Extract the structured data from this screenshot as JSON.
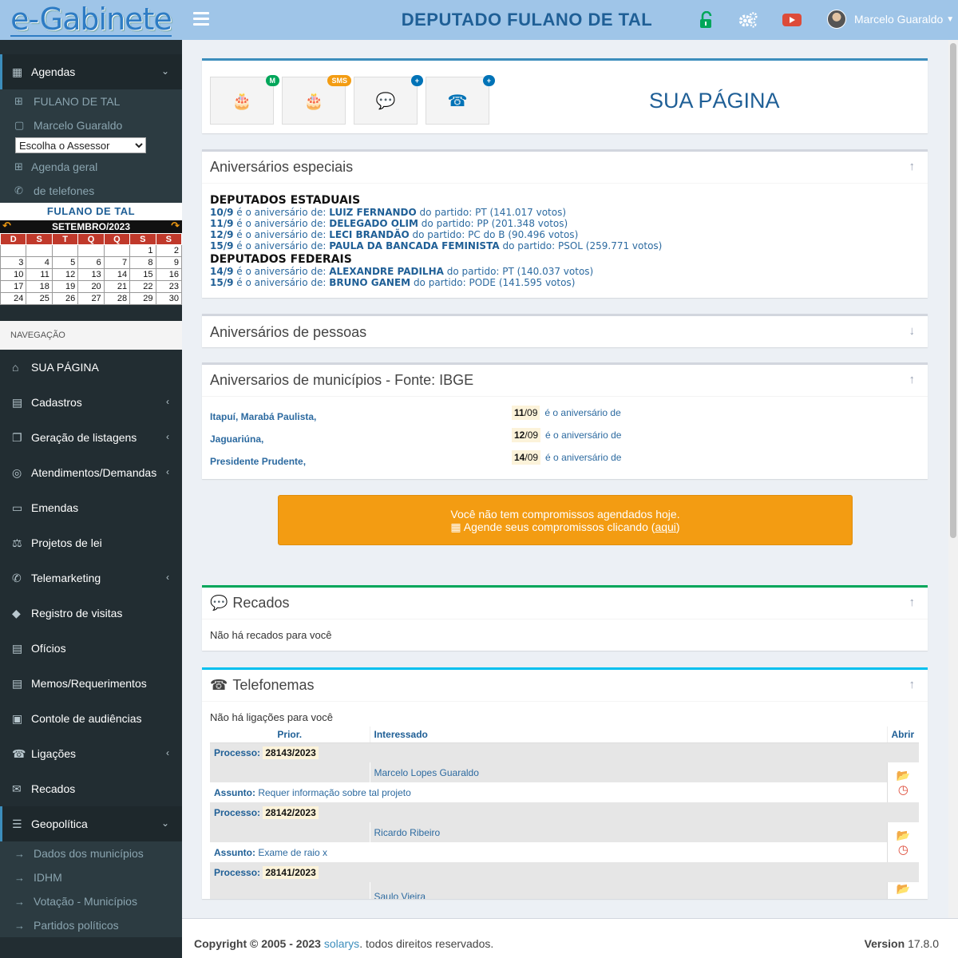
{
  "header": {
    "logo": "e-Gabinete",
    "title": "DEPUTADO FULANO DE TAL",
    "user": "Marcelo Guaraldo",
    "icons": [
      "lock-open-icon",
      "cogs-icon",
      "youtube-icon"
    ],
    "colors": {
      "bar": "#9fc5e8",
      "lock": "#00a65a",
      "youtube": "#dd4b39"
    }
  },
  "sidebar": {
    "agendas": {
      "label": "Agendas",
      "items": [
        "FULANO DE TAL",
        "Marcelo Guaraldo"
      ],
      "assessor_select": "Escolha o Assessor",
      "geral": "Agenda geral",
      "telefones": "de telefones"
    },
    "calendar": {
      "owner": "FULANO DE TAL",
      "month": "SETEMBRO/2023",
      "weekdays": [
        "D",
        "S",
        "T",
        "Q",
        "Q",
        "S",
        "S"
      ],
      "weeks": [
        [
          "",
          "",
          "",
          "",
          "",
          "1",
          "2"
        ],
        [
          "3",
          "4",
          "5",
          "6",
          "7",
          "8",
          "9"
        ],
        [
          "10",
          "11",
          "12",
          "13",
          "14",
          "15",
          "16"
        ],
        [
          "17",
          "18",
          "19",
          "20",
          "21",
          "22",
          "23"
        ],
        [
          "24",
          "25",
          "26",
          "27",
          "28",
          "29",
          "30"
        ]
      ]
    },
    "nav_label": "NAVEGAÇÃO",
    "nav": [
      {
        "label": "SUA PÁGINA",
        "icon": "home-icon",
        "chev": false
      },
      {
        "label": "Cadastros",
        "icon": "file-icon",
        "chev": true
      },
      {
        "label": "Geração de listagens",
        "icon": "copy-icon",
        "chev": true
      },
      {
        "label": "Atendimentos/Demandas",
        "icon": "lifering-icon",
        "chev": true
      },
      {
        "label": "Emendas",
        "icon": "money-icon",
        "chev": false
      },
      {
        "label": "Projetos de lei",
        "icon": "balance-icon",
        "chev": false
      },
      {
        "label": "Telemarketing",
        "icon": "phone-volume-icon",
        "chev": true
      },
      {
        "label": "Registro de visitas",
        "icon": "car-icon",
        "chev": false
      },
      {
        "label": "Ofícios",
        "icon": "file-text-icon",
        "chev": false
      },
      {
        "label": "Memos/Requerimentos",
        "icon": "file-text-icon",
        "chev": false
      },
      {
        "label": "Contole de audiências",
        "icon": "calendar-check-icon",
        "chev": false
      },
      {
        "label": "Ligações",
        "icon": "phone-square-icon",
        "chev": true
      },
      {
        "label": "Recados",
        "icon": "comments-icon",
        "chev": false
      }
    ],
    "geo": {
      "label": "Geopolítica",
      "items": [
        "Dados dos municípios",
        "IDHM",
        "Votação - Municípios",
        "Partidos políticos"
      ]
    }
  },
  "tiles": {
    "badges": [
      "M",
      "SMS",
      "+",
      "+"
    ],
    "icons": [
      "birthday-cake-icon",
      "birthday-cake-icon",
      "comments-icon",
      "phone-square-icon"
    ],
    "colors": [
      "#00a65a",
      "#f39c12",
      "#0073b7",
      "#0073b7"
    ],
    "page_title": "SUA PÁGINA"
  },
  "aniv_especiais": {
    "title": "Aniversários especiais",
    "estaduais_title": "DEPUTADOS ESTADUAIS",
    "estaduais": [
      {
        "date": "10/9",
        "name": "LUIZ FERNANDO",
        "party": "PT",
        "votes": "141.017 votos"
      },
      {
        "date": "11/9",
        "name": "DELEGADO OLIM",
        "party": "PP",
        "votes": "201.348 votos"
      },
      {
        "date": "12/9",
        "name": "LECI BRANDÃO",
        "party": "PC do B",
        "votes": "90.496 votos"
      },
      {
        "date": "15/9",
        "name": "PAULA DA BANCADA FEMINISTA",
        "party": "PSOL",
        "votes": "259.771 votos"
      }
    ],
    "federais_title": "DEPUTADOS FEDERAIS",
    "federais": [
      {
        "date": "14/9",
        "name": "ALEXANDRE PADILHA",
        "party": "PT",
        "votes": "140.037 votos"
      },
      {
        "date": "15/9",
        "name": "BRUNO GANEM",
        "party": "PODE",
        "votes": "141.595 votos"
      }
    ],
    "txt_aniv": "é o aniversário de:",
    "txt_partido": "do partido:"
  },
  "aniv_pessoas": {
    "title": "Aniversários de pessoas"
  },
  "aniv_municipios": {
    "title": "Aniversarios de municípios - Fonte: IBGE",
    "cities": [
      "Itapuí,  Marabá Paulista,",
      "Jaguariúna,",
      "Presidente Prudente,"
    ],
    "dates": [
      {
        "day": "11",
        "month": "/09"
      },
      {
        "day": "12",
        "month": "/09"
      },
      {
        "day": "14",
        "month": "/09"
      }
    ],
    "suffix": "é o aniversário de"
  },
  "alert": {
    "line1": "Você não tem compromissos agendados hoje.",
    "line2": "Agende seus compromissos clicando (",
    "link": "aqui",
    "close": ")"
  },
  "recados": {
    "title": "Recados",
    "empty": "Não há recados para você"
  },
  "telefonemas": {
    "title": "Telefonemas",
    "empty": "Não há ligações para você",
    "headers": {
      "prior": "Prior.",
      "interessado": "Interessado",
      "abrir": "Abrir"
    },
    "processo_label": "Processo:",
    "assunto_label": "Assunto:",
    "rows": [
      {
        "processo": "28143/2023",
        "interessado": "Marcelo Lopes Guaraldo",
        "assunto": "Requer informação sobre tal projeto"
      },
      {
        "processo": "28142/2023",
        "interessado": "Ricardo Ribeiro",
        "assunto": "Exame de raio x"
      },
      {
        "processo": "28141/2023",
        "interessado": "Saulo Vieira",
        "assunto": ""
      }
    ]
  },
  "footer": {
    "copyright": "Copyright © 2005 - 2023",
    "brand": "solarys",
    "rights": ". todos direitos reservados.",
    "version_label": "Version",
    "version": "17.8.0"
  }
}
